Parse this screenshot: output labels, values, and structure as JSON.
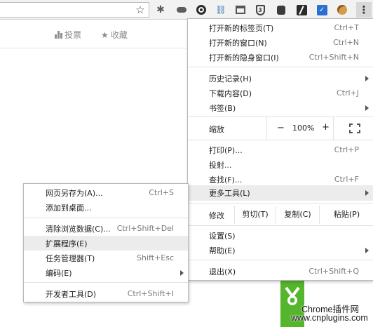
{
  "toolbar": {
    "icons": [
      "star-icon",
      "gear-icon",
      "cloud-icon",
      "circle-icon",
      "link-icon",
      "table-icon",
      "shield-icon",
      "robot-icon",
      "slash-icon",
      "vshield-icon",
      "cookie-icon",
      "kebab-menu-icon"
    ],
    "star_glyph": "☆",
    "gear_glyph": "✱",
    "link_glyph": "⛓",
    "shield_text": "3",
    "vshield_text": "✓",
    "kebab_glyph": "⋮"
  },
  "page": {
    "upvote_label": "投票",
    "favorite_glyph": "★",
    "favorite_label": "收藏"
  },
  "main_menu": {
    "new_tab": {
      "label": "打开新的标签页(T)",
      "shortcut": "Ctrl+T"
    },
    "new_window": {
      "label": "打开新的窗口(N)",
      "shortcut": "Ctrl+N"
    },
    "new_incognito": {
      "label": "打开新的隐身窗口(I)",
      "shortcut": "Ctrl+Shift+N"
    },
    "history": {
      "label": "历史记录(H)"
    },
    "downloads": {
      "label": "下载内容(D)",
      "shortcut": "Ctrl+J"
    },
    "bookmarks": {
      "label": "书签(B)"
    },
    "zoom": {
      "label": "缩放",
      "minus": "−",
      "value": "100%",
      "plus": "+"
    },
    "print": {
      "label": "打印(P)...",
      "shortcut": "Ctrl+P"
    },
    "cast": {
      "label": "投射..."
    },
    "find": {
      "label": "查找(F)...",
      "shortcut": "Ctrl+F"
    },
    "more_tools": {
      "label": "更多工具(L)"
    },
    "edit": {
      "label": "修改",
      "cut": "剪切(T)",
      "copy": "复制(C)",
      "paste": "粘贴(P)"
    },
    "settings": {
      "label": "设置(S)"
    },
    "help": {
      "label": "帮助(E)"
    },
    "exit": {
      "label": "退出(X)",
      "shortcut": "Ctrl+Shift+Q"
    }
  },
  "sub_menu": {
    "save_page": {
      "label": "网页另存为(A)...",
      "shortcut": "Ctrl+S"
    },
    "add_to_desktop": {
      "label": "添加到桌面..."
    },
    "clear_data": {
      "label": "清除浏览数据(C)...",
      "shortcut": "Ctrl+Shift+Del"
    },
    "extensions": {
      "label": "扩展程序(E)"
    },
    "task_manager": {
      "label": "任务管理器(T)",
      "shortcut": "Shift+Esc"
    },
    "encoding": {
      "label": "编码(E)"
    },
    "dev_tools": {
      "label": "开发者工具(D)",
      "shortcut": "Ctrl+Shift+I"
    }
  },
  "watermark": {
    "line1": "Chrome插件网",
    "line2": "www.cnplugins.com",
    "logo_color": "#55b52c"
  }
}
